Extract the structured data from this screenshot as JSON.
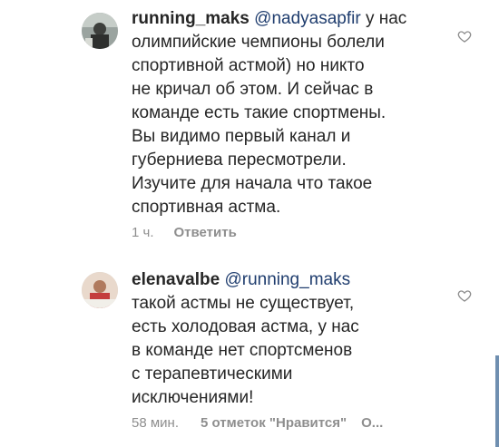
{
  "comments": [
    {
      "username": "running_maks",
      "mention": "@nadyasapfir",
      "lines": [
        " у нас",
        "олимпийские чемпионы болели",
        "спортивной астмой) но никто",
        "не кричал об этом. И сейчас в",
        "команде есть такие спортмены.",
        "Вы видимо первый канал и",
        "губерниева пересмотрели.",
        "Изучите для начала что такое",
        "спортивная астма."
      ],
      "time": "1 ч.",
      "reply_label": "Ответить",
      "avatar_color": "#7d8a86"
    },
    {
      "username": "elenavalbe",
      "mention": "@running_maks",
      "lines": [
        "",
        "такой астмы не существует,",
        "есть холодовая астма, у нас",
        "в команде нет спортсменов",
        "с терапевтическими",
        "исключениями!"
      ],
      "time": "58 мин.",
      "likes_label": "5 отметок \"Нравится\"",
      "more_label": "О...",
      "avatar_color": "#c9a48c"
    }
  ],
  "colors": {
    "text": "#262626",
    "mention": "#1f3d6e",
    "meta": "#8e8e8e"
  },
  "icons": [
    "heart-outline-icon",
    "heart-outline-icon"
  ]
}
